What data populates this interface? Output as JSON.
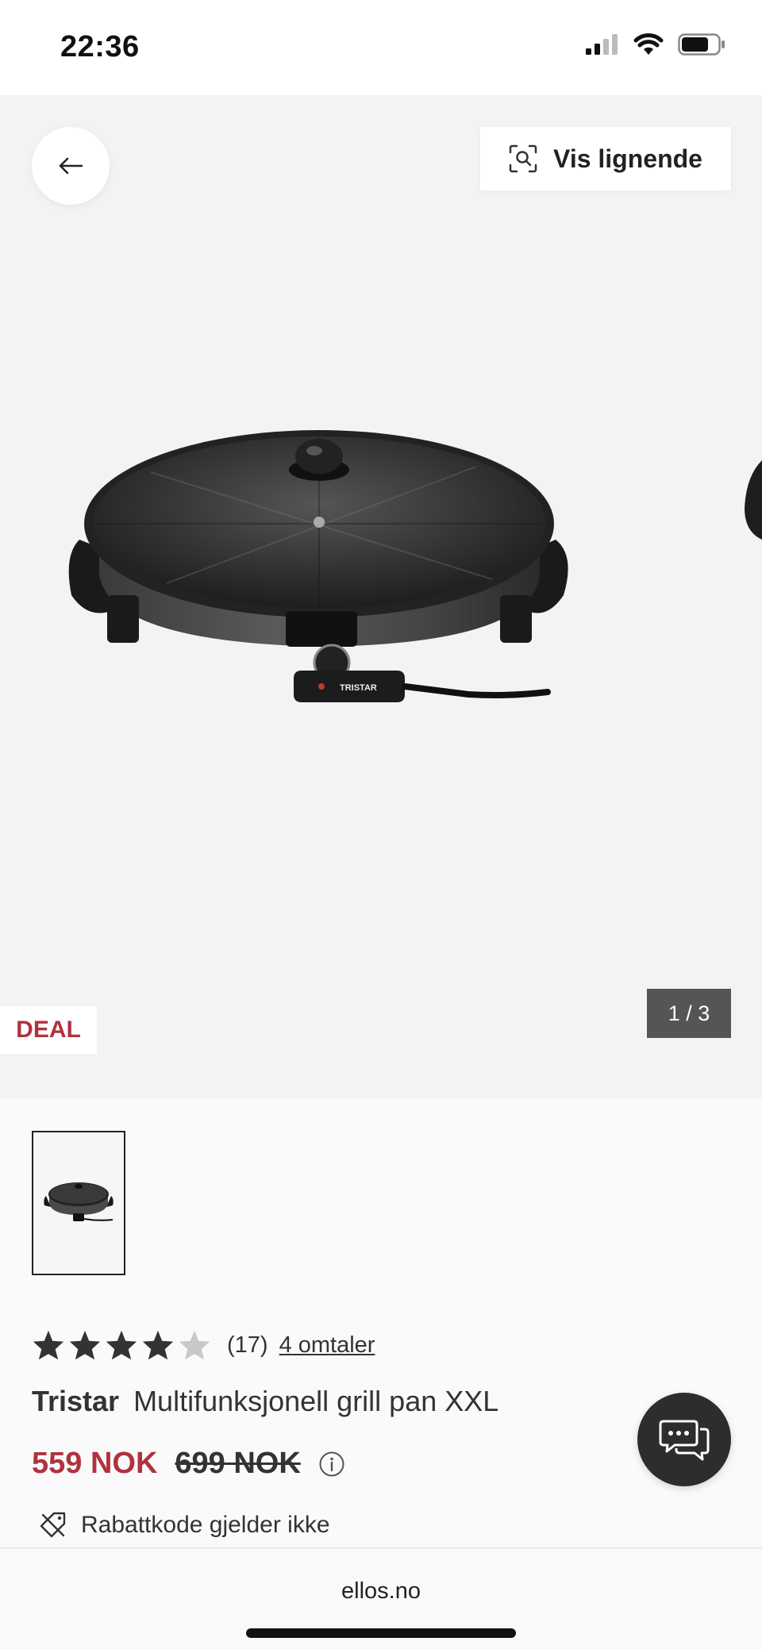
{
  "status_bar": {
    "time": "22:36",
    "battery_level": 0.75
  },
  "hero": {
    "similar_button_label": "Vis lignende",
    "deal_badge": "DEAL",
    "image_counter": "1 / 3",
    "image_brand_text": "TRISTAR"
  },
  "product": {
    "rating": 4,
    "rating_max": 5,
    "rating_count": "(17)",
    "reviews_link": "4 omtaler",
    "brand": "Tristar",
    "name": "Multifunksjonell grill pan XXL",
    "price_current": "559 NOK",
    "price_old": "699 NOK",
    "discount_note": "Rabattkode gjelder ikke"
  },
  "browser": {
    "url": "ellos.no"
  },
  "colors": {
    "accent": "#b0323e",
    "counter_bg": "#555555",
    "chat_bg": "#2d2d2d"
  }
}
